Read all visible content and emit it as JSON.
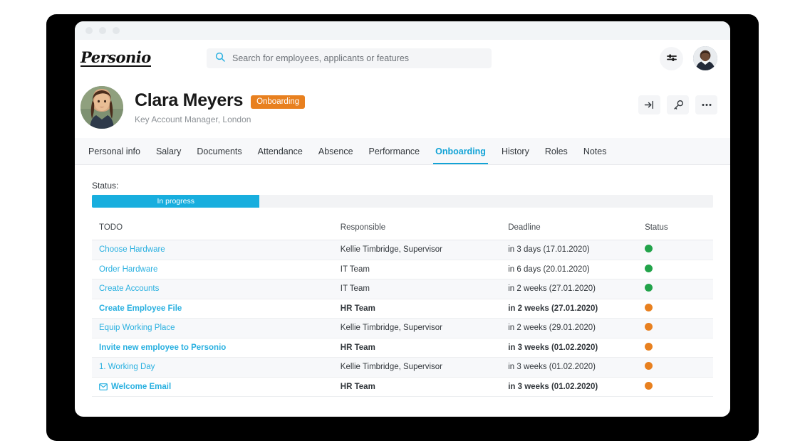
{
  "window": {
    "traffic_dots": 3
  },
  "topnav": {
    "logo_text": "Personio",
    "search": {
      "icon": "search-icon",
      "placeholder": "Search for employees, applicants or features",
      "value": ""
    },
    "settings_icon": "sliders-icon",
    "avatar": "user-avatar"
  },
  "profile": {
    "avatar": "employee-avatar",
    "name": "Clara Meyers",
    "badge": "Onboarding",
    "badge_color": "#e8801f",
    "subtitle": "Key Account Manager, London",
    "actions": [
      {
        "icon": "login-arrow-icon",
        "name": "impersonate-button"
      },
      {
        "icon": "key-icon",
        "name": "permissions-button"
      },
      {
        "icon": "ellipsis-icon",
        "name": "more-options-button"
      }
    ]
  },
  "tabs": [
    {
      "label": "Personal info",
      "active": false
    },
    {
      "label": "Salary",
      "active": false
    },
    {
      "label": "Documents",
      "active": false
    },
    {
      "label": "Attendance",
      "active": false
    },
    {
      "label": "Absence",
      "active": false
    },
    {
      "label": "Performance",
      "active": false
    },
    {
      "label": "Onboarding",
      "active": true
    },
    {
      "label": "History",
      "active": false
    },
    {
      "label": "Roles",
      "active": false
    },
    {
      "label": "Notes",
      "active": false
    }
  ],
  "status": {
    "label": "Status:",
    "progress_text": "In progress",
    "progress_percent": 27,
    "fill_color": "#18aede",
    "track_color": "#f2f3f5"
  },
  "table": {
    "headers": [
      "TODO",
      "Responsible",
      "Deadline",
      "Status"
    ],
    "status_colors": {
      "green": "#22a34a",
      "orange": "#e8801f"
    },
    "rows": [
      {
        "todo": "Choose Hardware",
        "responsible": "Kellie Timbridge, Supervisor",
        "deadline": "in 3 days (17.01.2020)",
        "status": "green",
        "bold": false,
        "icon": ""
      },
      {
        "todo": "Order Hardware",
        "responsible": "IT Team",
        "deadline": "in 6 days (20.01.2020)",
        "status": "green",
        "bold": false,
        "icon": ""
      },
      {
        "todo": "Create Accounts",
        "responsible": "IT Team",
        "deadline": "in 2 weeks (27.01.2020)",
        "status": "green",
        "bold": false,
        "icon": ""
      },
      {
        "todo": "Create Employee File",
        "responsible": "HR Team",
        "deadline": "in 2 weeks (27.01.2020)",
        "status": "orange",
        "bold": true,
        "icon": ""
      },
      {
        "todo": "Equip Working Place",
        "responsible": "Kellie Timbridge, Supervisor",
        "deadline": "in 2 weeks (29.01.2020)",
        "status": "orange",
        "bold": false,
        "icon": ""
      },
      {
        "todo": "Invite new employee to Personio",
        "responsible": "HR Team",
        "deadline": "in 3 weeks (01.02.2020)",
        "status": "orange",
        "bold": true,
        "icon": ""
      },
      {
        "todo": "1. Working Day",
        "responsible": "Kellie Timbridge, Supervisor",
        "deadline": "in 3 weeks (01.02.2020)",
        "status": "orange",
        "bold": false,
        "icon": ""
      },
      {
        "todo": "Welcome Email",
        "responsible": "HR Team",
        "deadline": "in 3 weeks (01.02.2020)",
        "status": "orange",
        "bold": true,
        "icon": "mail-icon"
      }
    ]
  }
}
